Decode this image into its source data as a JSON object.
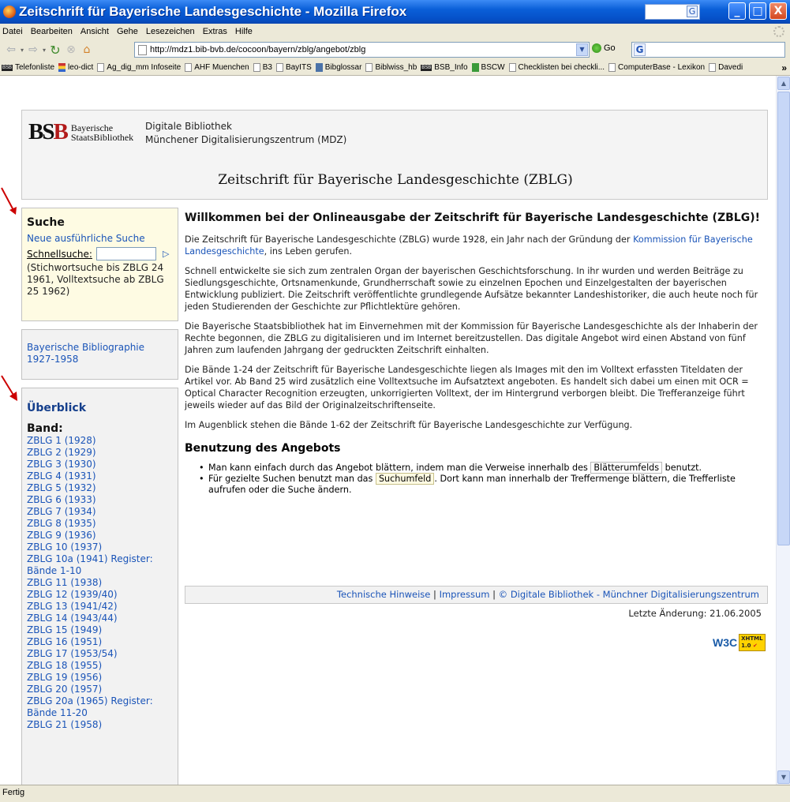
{
  "window": {
    "title": "Zeitschrift für Bayerische Landesgeschichte - Mozilla Firefox",
    "search_engine_glyph": "G",
    "controls": {
      "minimize": "_",
      "maximize": "□",
      "close": "X"
    }
  },
  "menu": [
    "Datei",
    "Bearbeiten",
    "Ansicht",
    "Gehe",
    "Lesezeichen",
    "Extras",
    "Hilfe"
  ],
  "toolbar": {
    "url": "http://mdz1.bib-bvb.de/cocoon/bayern/zblg/angebot/zblg",
    "go_label": "Go",
    "search_glyph": "G"
  },
  "bookmarks": [
    {
      "label": "Telefonliste",
      "icon": "bsb"
    },
    {
      "label": "leo-dict",
      "icon": "flag"
    },
    {
      "label": "Ag_dig_mm Infoseite",
      "icon": "page"
    },
    {
      "label": "AHF Muenchen",
      "icon": "page"
    },
    {
      "label": "B3",
      "icon": "page"
    },
    {
      "label": "BayITS",
      "icon": "page"
    },
    {
      "label": "Bibglossar",
      "icon": "book"
    },
    {
      "label": "Biblwiss_hb",
      "icon": "page"
    },
    {
      "label": "BSB_Info",
      "icon": "bsb"
    },
    {
      "label": "BSCW",
      "icon": "green"
    },
    {
      "label": "Checklisten bei checkli...",
      "icon": "page"
    },
    {
      "label": "ComputerBase - Lexikon",
      "icon": "page"
    },
    {
      "label": "Davedi",
      "icon": "page"
    }
  ],
  "bookmarks_more": "»",
  "header": {
    "logo_text": "BSB",
    "logo_name_line1": "Bayerische",
    "logo_name_line2": "StaatsBibliothek",
    "sub_line1": "Digitale Bibliothek",
    "sub_line2": "Münchener Digitalisierungszentrum (MDZ)",
    "title": "Zeitschrift für Bayerische Landesgeschichte (ZBLG)"
  },
  "suche": {
    "heading": "Suche",
    "link": "Neue ausführliche Suche",
    "schnell_label": "Schnellsuche:",
    "go_glyph": "▷",
    "note": "(Stichwortsuche bis ZBLG 24 1961, Volltextsuche ab ZBLG 25 1962)"
  },
  "bibliographie": {
    "link": "Bayerische Bibliographie 1927-1958"
  },
  "ueberblick": {
    "heading": "Überblick",
    "band_label": "Band:",
    "items": [
      "ZBLG 1 (1928)",
      "ZBLG 2 (1929)",
      "ZBLG 3 (1930)",
      "ZBLG 4 (1931)",
      "ZBLG 5 (1932)",
      "ZBLG 6 (1933)",
      "ZBLG 7 (1934)",
      "ZBLG 8 (1935)",
      "ZBLG 9 (1936)",
      "ZBLG 10 (1937)",
      "ZBLG 10a (1941) Register: Bände 1-10",
      "ZBLG 11 (1938)",
      "ZBLG 12 (1939/40)",
      "ZBLG 13 (1941/42)",
      "ZBLG 14 (1943/44)",
      "ZBLG 15 (1949)",
      "ZBLG 16 (1951)",
      "ZBLG 17 (1953/54)",
      "ZBLG 18 (1955)",
      "ZBLG 19 (1956)",
      "ZBLG 20 (1957)",
      "ZBLG 20a (1965) Register: Bände 11-20",
      "ZBLG 21 (1958)"
    ]
  },
  "main": {
    "heading": "Willkommen bei der Onlineausgabe der Zeitschrift für Bayerische Landesgeschichte (ZBLG)!",
    "p1_before": "Die Zeitschrift für Bayerische Landesgeschichte (ZBLG) wurde 1928, ein Jahr nach der Gründung der ",
    "p1_link": "Kommission für Bayerische Landesgeschichte",
    "p1_after": ", ins Leben gerufen.",
    "p2": "Schnell entwickelte sie sich zum zentralen Organ der bayerischen Geschichtsforschung. In ihr wurden und werden Beiträge zu Siedlungsgeschichte, Ortsnamenkunde, Grundherrschaft sowie zu einzelnen Epochen und Einzelgestalten der bayerischen Entwicklung publiziert. Die Zeitschrift veröffentlichte grundlegende Aufsätze bekannter Landeshistoriker, die auch heute noch für jeden Studierenden der Geschichte zur Pflichtlektüre gehören.",
    "p3": "Die Bayerische Staatsbibliothek hat im Einvernehmen mit der Kommission für Bayerische Landesgeschichte als der Inhaberin der Rechte begonnen, die ZBLG zu digitalisieren und im Internet bereitzustellen. Das digitale Angebot wird einen Abstand von fünf Jahren zum laufenden Jahrgang der gedruckten Zeitschrift einhalten.",
    "p4": "Die Bände 1-24 der Zeitschrift für Bayerische Landesgeschichte liegen als Images mit den im Volltext erfassten Titeldaten der Artikel vor. Ab Band 25 wird zusätzlich eine Volltextsuche im Aufsatztext angeboten. Es handelt sich dabei um einen mit OCR = Optical Character Recognition erzeugten, unkorrigierten Volltext, der im Hintergrund verborgen bleibt. Die Trefferanzeige führt jeweils wieder auf das Bild der Originalzeitschriftenseite.",
    "p5": "Im Augenblick stehen die Bände 1-62 der Zeitschrift für Bayerische Landesgeschichte zur Verfügung.",
    "h2": "Benutzung des Angebots",
    "li1_before": "Man kann einfach durch das Angebot blättern, indem man die Verweise innerhalb des ",
    "li1_box": "Blätterumfelds",
    "li1_after": " benutzt.",
    "li2_before": "Für gezielte Suchen benutzt man das ",
    "li2_box": "Suchumfeld",
    "li2_after": ". Dort kann man innerhalb der Treffermenge blättern, die Trefferliste aufrufen oder die Suche ändern."
  },
  "footer": {
    "link1": "Technische Hinweise",
    "sep": "|",
    "link2": "Impressum",
    "link3": "© Digitale Bibliothek - Münchner Digitalisierungszentrum",
    "last_modified": "Letzte Änderung: 21.06.2005",
    "badge_w3c": "W3C",
    "badge_xhtml": "XHTML",
    "badge_version": "1.0"
  },
  "status": "Fertig",
  "colors": {
    "link": "#1a54b8",
    "titlebar": "#0a5fd8",
    "chrome": "#ece9d8",
    "annotation_arrow": "#cc0000"
  }
}
